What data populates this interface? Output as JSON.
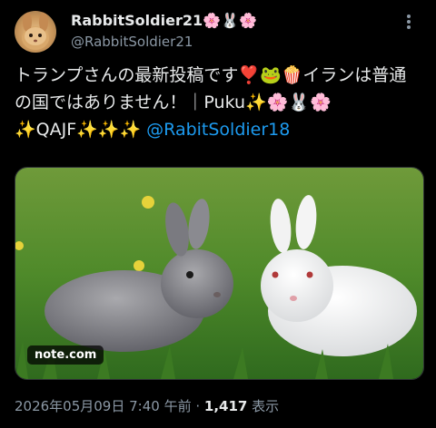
{
  "author": {
    "display_name": "RabbitSoldier21🌸🐰🌸",
    "handle": "@RabbitSoldier21",
    "avatar_icon": "rabbit-avatar-icon"
  },
  "post": {
    "text": "トランプさんの最新投稿です❣️🐸🍿イランは普通の国ではありません！｜Puku✨🌸🐰🌸✨QAJF✨✨✨ ",
    "mention": "@RabitSoldier18"
  },
  "media": {
    "badge": "note.com",
    "description_icon": "two-rabbits-photo"
  },
  "meta": {
    "timestamp": "2026年05月09日 7:40 午前",
    "separator": "·",
    "views_count": "1,417",
    "views_label": "表示"
  },
  "colors": {
    "background": "#000000",
    "text": "#e7e9ea",
    "secondary": "#8b98a5",
    "link": "#1d9bf0"
  }
}
